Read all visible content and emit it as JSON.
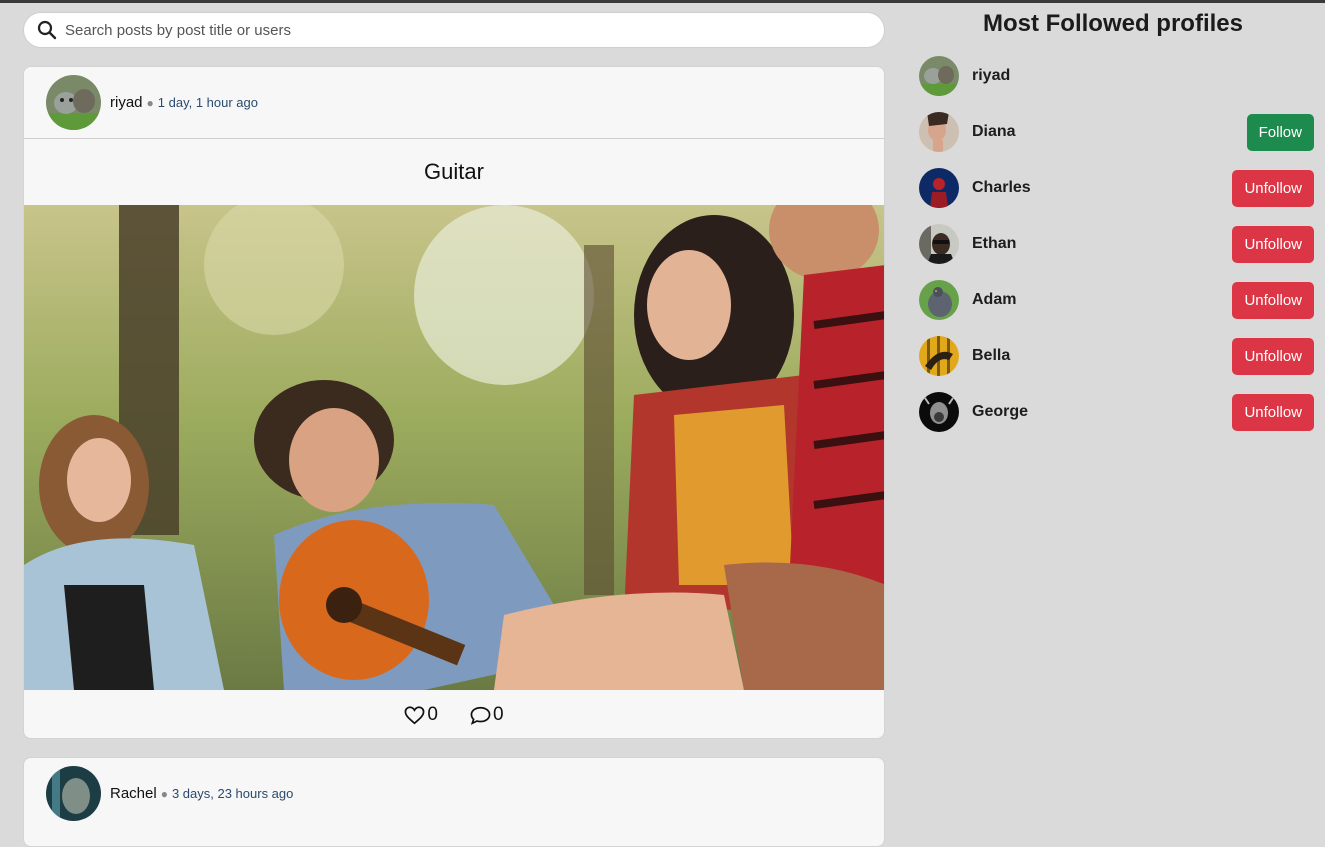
{
  "search": {
    "placeholder": "Search posts by post title or users"
  },
  "posts": [
    {
      "author": "riyad",
      "time": "1 day, 1 hour ago",
      "title": "Guitar",
      "likes": "0",
      "comments": "0"
    },
    {
      "author": "Rachel",
      "time": "3 days, 23 hours ago"
    }
  ],
  "sidebar": {
    "title": "Most Followed profiles",
    "profiles": [
      {
        "name": "riyad",
        "button": ""
      },
      {
        "name": "Diana",
        "button": "Follow"
      },
      {
        "name": "Charles",
        "button": "Unfollow"
      },
      {
        "name": "Ethan",
        "button": "Unfollow"
      },
      {
        "name": "Adam",
        "button": "Unfollow"
      },
      {
        "name": "Bella",
        "button": "Unfollow"
      },
      {
        "name": "George",
        "button": "Unfollow"
      }
    ]
  },
  "colors": {
    "follow": "#1d8a4e",
    "unfollow": "#dc3545",
    "background": "#dadada"
  }
}
